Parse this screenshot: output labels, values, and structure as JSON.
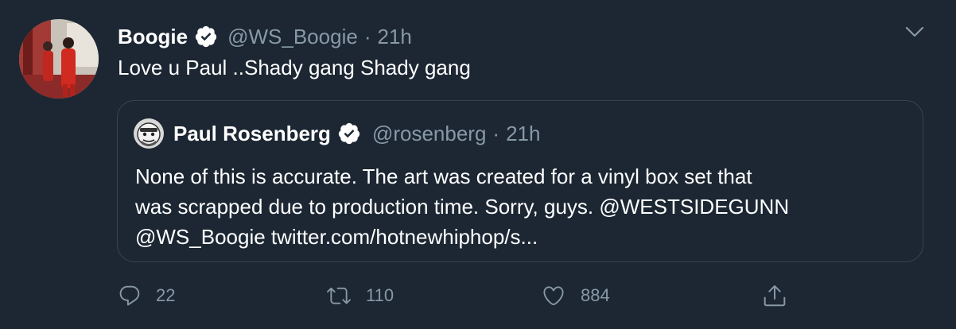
{
  "tweet": {
    "author_name": "Boogie",
    "author_handle": "@WS_Boogie",
    "separator": "·",
    "time": "21h",
    "text": "Love u Paul ..Shady gang Shady gang"
  },
  "quoted": {
    "author_name": "Paul Rosenberg",
    "author_handle": "@rosenberg",
    "separator": "·",
    "time": "21h",
    "lines": [
      "None of this is accurate. The art was created for a vinyl box set that",
      "was scrapped due to production time.  Sorry, guys. @WESTSIDEGUNN",
      "@WS_Boogie twitter.com/hotnewhiphop/s..."
    ]
  },
  "actions": {
    "reply_count": "22",
    "retweet_count": "110",
    "like_count": "884"
  },
  "icons": {
    "verified": "verified-badge-icon",
    "caret": "chevron-down-icon",
    "reply": "reply-icon",
    "retweet": "retweet-icon",
    "like": "heart-icon",
    "share": "share-icon"
  },
  "colors": {
    "background": "#1c2733",
    "primary_text": "#ffffff",
    "secondary_text": "#8899a6",
    "border": "#38444d"
  }
}
